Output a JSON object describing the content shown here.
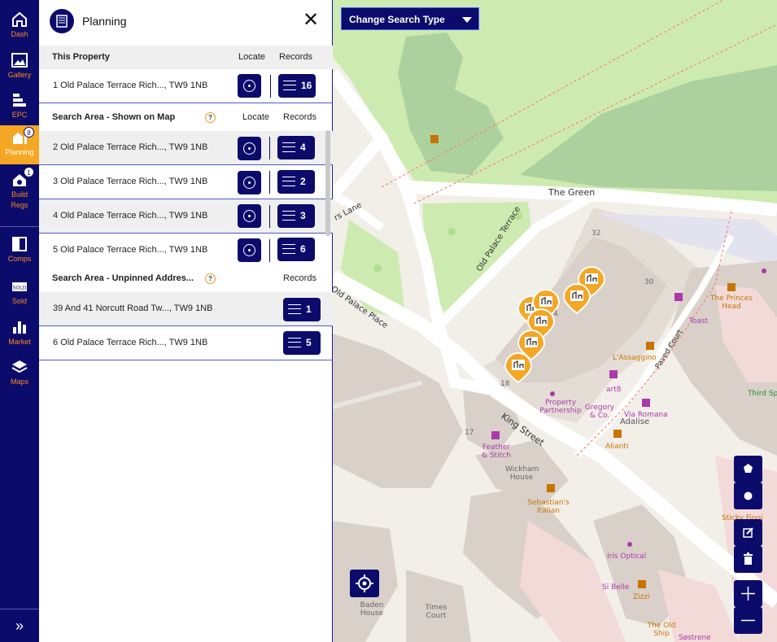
{
  "nav": {
    "items": [
      {
        "label": "Dash",
        "icon": "home-icon"
      },
      {
        "label": "Gallery",
        "icon": "image-icon"
      },
      {
        "label": "EPC",
        "icon": "epc-icon"
      },
      {
        "label": "Planning",
        "icon": "planning-icon",
        "badge": "8"
      },
      {
        "label": "Build",
        "label2": "Regs",
        "icon": "build-regs-icon",
        "badge": "1"
      },
      {
        "label": "Comps",
        "icon": "comps-icon"
      },
      {
        "label": "Sold",
        "icon": "sold-icon"
      },
      {
        "label": "Market",
        "icon": "bar-chart-icon"
      },
      {
        "label": "Maps",
        "icon": "layers-icon"
      }
    ],
    "expand": "»"
  },
  "panel": {
    "title": "Planning",
    "close": "✕",
    "this_property": {
      "heading": "This Property",
      "locate": "Locate",
      "records": "Records",
      "rows": [
        {
          "address": "1 Old Palace Terrace Rich..., TW9 1NB",
          "count": "16"
        }
      ]
    },
    "search_area": {
      "heading": "Search Area - Shown on Map",
      "help": "?",
      "locate": "Locate",
      "records": "Records",
      "rows": [
        {
          "address": "2 Old Palace Terrace Rich..., TW9 1NB",
          "count": "4"
        },
        {
          "address": "3 Old Palace Terrace Rich..., TW9 1NB",
          "count": "2"
        },
        {
          "address": "4 Old Palace Terrace Rich..., TW9 1NB",
          "count": "3"
        },
        {
          "address": "5 Old Palace Terrace Rich..., TW9 1NB",
          "count": "6"
        }
      ]
    },
    "unpinned": {
      "heading": "Search Area - Unpinned Addres...",
      "help": "?",
      "records": "Records",
      "rows": [
        {
          "address": "39 And 41 Norcutt Road Tw..., TW9 1NB",
          "count": "1"
        },
        {
          "address": "6 Old Palace Terrace Rich..., TW9 1NB",
          "count": "5"
        }
      ]
    }
  },
  "map": {
    "search_type": "Change Search Type",
    "labels": {
      "the_green": "The Green",
      "old_palace_terrace": "Old Palace Terrace",
      "old_palace_place": "Old Palace Place",
      "lane": "rs Lane",
      "king_street": "King Street",
      "paved_court": "Paved Court",
      "n32": "32",
      "n30": "30",
      "n18": "18",
      "n17": "17",
      "n4": "4",
      "property_partnership": "Property Partnership",
      "feather_stitch": "Feather & Stitch",
      "wickham_house": "Wickham House",
      "sebastians": "Sebastian's Italian",
      "lassaggino": "L'Assaggino",
      "art8": "art8",
      "gregory": "Gregory & Co.",
      "via_romana": "Via Romana",
      "adalise": "Adalise",
      "alianti": "Alianti",
      "princes_head": "The Princes Head",
      "toast": "Toast",
      "third_space": "Third Sp",
      "iris_optical": "Iris Optical",
      "si_belle": "Si Belle",
      "zizzi": "Zizzi",
      "the_old_ship": "The Old Ship",
      "sostrene": "Søstrene",
      "baden_house": "Baden House",
      "times_court": "Times Court",
      "sticky_fingers": "Sticky Fingi"
    },
    "controls": [
      "polygon-icon",
      "circle-icon",
      "edit-icon",
      "trash-icon",
      "zoom-in-icon",
      "zoom-out-icon"
    ],
    "colors": {
      "primary": "#0b0b6b",
      "accent": "#f5a623",
      "park": "#cdebb0",
      "building": "#d9d0c9",
      "road": "#ffffff"
    }
  }
}
